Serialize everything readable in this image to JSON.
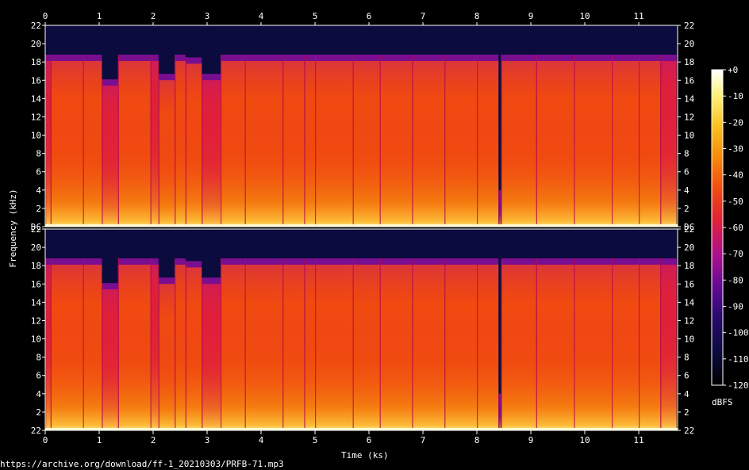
{
  "source_url": "https://archive.org/download/ff-1_20210303/PRFB-71.mp3",
  "colors": {
    "background": "#000000",
    "text": "#ffffff",
    "palette": [
      "#000000",
      "#0a0a3c",
      "#2a0a70",
      "#6a0a95",
      "#b0108a",
      "#e0203a",
      "#f04a10",
      "#f8880a",
      "#fbc020",
      "#fff27a",
      "#ffffff"
    ]
  },
  "chart_data": {
    "type": "heatmap",
    "title": "",
    "xlabel": "Time (ks)",
    "ylabel": "Frequency (kHz)",
    "x_ticks": [
      "0",
      "1",
      "2",
      "3",
      "4",
      "5",
      "6",
      "7",
      "8",
      "9",
      "10",
      "11"
    ],
    "xlim": [
      0,
      11.7
    ],
    "channels": [
      {
        "name": "",
        "ylim": [
          0,
          22
        ],
        "y_ticks": [
          "DC",
          "2",
          "4",
          "6",
          "8",
          "10",
          "12",
          "14",
          "16",
          "18",
          "20",
          "22"
        ]
      },
      {
        "name": "",
        "ylim": [
          0,
          22
        ],
        "y_ticks": [
          "22",
          "2",
          "4",
          "6",
          "8",
          "10",
          "12",
          "14",
          "16",
          "18",
          "20",
          "22"
        ]
      }
    ],
    "colorbar": {
      "label": "dBFS",
      "range": [
        -120,
        0
      ],
      "ticks": [
        "+0",
        "-10",
        "-20",
        "-30",
        "-40",
        "-50",
        "-60",
        "-70",
        "-80",
        "-90",
        "-100",
        "-110",
        "-120"
      ]
    },
    "segments": [
      {
        "t0": 0.0,
        "t1": 0.1,
        "cutoff_khz": 18.8,
        "level_db": -55
      },
      {
        "t0": 0.1,
        "t1": 0.7,
        "cutoff_khz": 18.8,
        "level_db": -50
      },
      {
        "t0": 0.7,
        "t1": 1.05,
        "cutoff_khz": 18.8,
        "level_db": -52
      },
      {
        "t0": 1.05,
        "t1": 1.35,
        "cutoff_khz": 16.1,
        "level_db": -55
      },
      {
        "t0": 1.35,
        "t1": 1.95,
        "cutoff_khz": 18.8,
        "level_db": -48
      },
      {
        "t0": 1.95,
        "t1": 2.1,
        "cutoff_khz": 18.8,
        "level_db": -55
      },
      {
        "t0": 2.1,
        "t1": 2.4,
        "cutoff_khz": 16.7,
        "level_db": -53
      },
      {
        "t0": 2.4,
        "t1": 2.6,
        "cutoff_khz": 18.8,
        "level_db": -50
      },
      {
        "t0": 2.6,
        "t1": 2.9,
        "cutoff_khz": 18.5,
        "level_db": -52
      },
      {
        "t0": 2.9,
        "t1": 3.25,
        "cutoff_khz": 16.7,
        "level_db": -55
      },
      {
        "t0": 3.25,
        "t1": 3.7,
        "cutoff_khz": 18.8,
        "level_db": -50
      },
      {
        "t0": 3.7,
        "t1": 4.4,
        "cutoff_khz": 18.8,
        "level_db": -48
      },
      {
        "t0": 4.4,
        "t1": 4.8,
        "cutoff_khz": 18.8,
        "level_db": -52
      },
      {
        "t0": 4.8,
        "t1": 5.0,
        "cutoff_khz": 18.8,
        "level_db": -45
      },
      {
        "t0": 5.0,
        "t1": 5.7,
        "cutoff_khz": 18.8,
        "level_db": -50
      },
      {
        "t0": 5.7,
        "t1": 6.2,
        "cutoff_khz": 18.8,
        "level_db": -47
      },
      {
        "t0": 6.2,
        "t1": 6.8,
        "cutoff_khz": 18.8,
        "level_db": -52
      },
      {
        "t0": 6.8,
        "t1": 7.4,
        "cutoff_khz": 18.8,
        "level_db": -48
      },
      {
        "t0": 7.4,
        "t1": 8.0,
        "cutoff_khz": 18.8,
        "level_db": -50
      },
      {
        "t0": 8.0,
        "t1": 8.4,
        "cutoff_khz": 18.8,
        "level_db": -47
      },
      {
        "t0": 8.4,
        "t1": 8.45,
        "cutoff_khz": 4.0,
        "level_db": -90
      },
      {
        "t0": 8.45,
        "t1": 9.1,
        "cutoff_khz": 18.8,
        "level_db": -50
      },
      {
        "t0": 9.1,
        "t1": 9.8,
        "cutoff_khz": 18.8,
        "level_db": -48
      },
      {
        "t0": 9.8,
        "t1": 10.5,
        "cutoff_khz": 18.8,
        "level_db": -50
      },
      {
        "t0": 10.5,
        "t1": 11.0,
        "cutoff_khz": 18.8,
        "level_db": -52
      },
      {
        "t0": 11.0,
        "t1": 11.4,
        "cutoff_khz": 18.8,
        "level_db": -54
      },
      {
        "t0": 11.4,
        "t1": 11.7,
        "cutoff_khz": 18.8,
        "level_db": -56
      }
    ]
  }
}
